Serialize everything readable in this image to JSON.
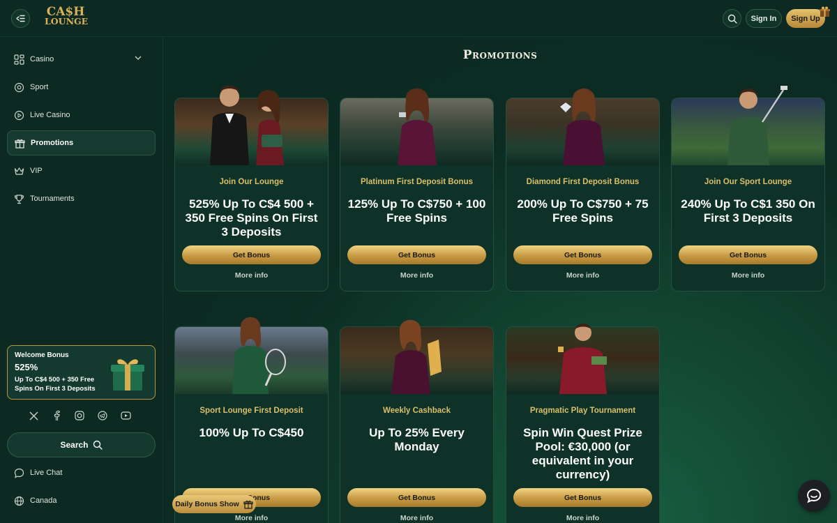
{
  "header": {
    "logo_line1": "CA$H",
    "logo_line2": "LOUNGE",
    "signin_label": "Sign In",
    "signup_label": "Sign Up"
  },
  "sidebar": {
    "items": [
      {
        "label": "Casino",
        "icon": "grid-icon"
      },
      {
        "label": "Sport",
        "icon": "ball-icon"
      },
      {
        "label": "Live Casino",
        "icon": "play-icon"
      },
      {
        "label": "Promotions",
        "icon": "gift-icon"
      },
      {
        "label": "VIP",
        "icon": "crown-icon"
      },
      {
        "label": "Tournaments",
        "icon": "trophy-icon"
      }
    ],
    "welcome": {
      "title": "Welcome Bonus",
      "percent": "525%",
      "desc": "Up To C$4 500 + 350 Free Spins On First 3 Deposits"
    },
    "search_label": "Search",
    "live_chat_label": "Live Chat",
    "country_label": "Canada"
  },
  "main": {
    "title": "Promotions",
    "cards": [
      {
        "subtitle": "Join Our Lounge",
        "headline": "525% Up To C$4 500 + 350 Free Spins On First 3 Deposits",
        "button": "Get Bonus",
        "more": "More info"
      },
      {
        "subtitle": "Platinum First Deposit Bonus",
        "headline": "125% Up To C$750 + 100 Free Spins",
        "button": "Get Bonus",
        "more": "More info"
      },
      {
        "subtitle": "Diamond First Deposit Bonus",
        "headline": "200% Up To C$750 + 75 Free Spins",
        "button": "Get Bonus",
        "more": "More info"
      },
      {
        "subtitle": "Join Our Sport Lounge",
        "headline": "240% Up To C$1 350 On First 3 Deposits",
        "button": "Get Bonus",
        "more": "More info"
      },
      {
        "subtitle": "Sport Lounge First Deposit",
        "headline": "100% Up To C$450",
        "button": "Get Bonus",
        "more": "More info"
      },
      {
        "subtitle": "Weekly Cashback",
        "headline": "Up To 25% Every Monday",
        "button": "Get Bonus",
        "more": "More info"
      },
      {
        "subtitle": "Pragmatic Play Tournament",
        "headline": "Spin Win Quest Prize Pool: €30,000 (or equivalent in your currency)",
        "button": "Get Bonus",
        "more": "More info"
      }
    ]
  },
  "daily_bonus_label": "Daily Bonus Show",
  "colors": {
    "gold": "#d9bf6a",
    "bg": "#0b2a22",
    "card": "#0e3228"
  }
}
